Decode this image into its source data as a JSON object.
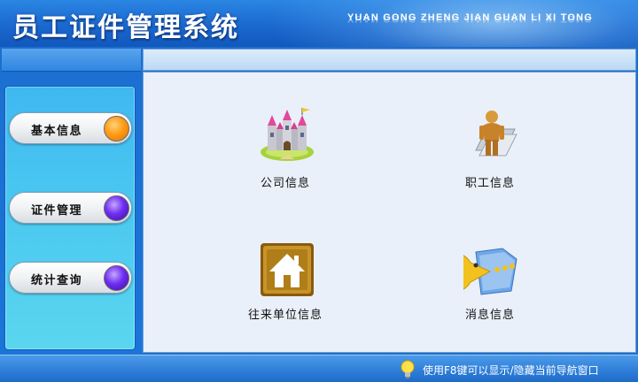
{
  "header": {
    "title": "员工证件管理系统",
    "subtitle": "YUAN GONG ZHENG JIAN GUAN LI XI TONG"
  },
  "sidebar": {
    "items": [
      {
        "label": "基本信息",
        "dot_color": "#ff9c16"
      },
      {
        "label": "证件管理",
        "dot_color": "#6e2ef0"
      },
      {
        "label": "统计查询",
        "dot_color": "#6e2ef0"
      }
    ]
  },
  "main": {
    "tiles": [
      {
        "label": "公司信息",
        "icon": "castle-icon"
      },
      {
        "label": "职工信息",
        "icon": "person-icon"
      },
      {
        "label": "往来单位信息",
        "icon": "house-icon"
      },
      {
        "label": "消息信息",
        "icon": "pacman-folder-icon"
      }
    ]
  },
  "footer": {
    "hint": "使用F8键可以显示/隐藏当前导航窗口",
    "icon": "lightbulb-icon"
  },
  "colors": {
    "header_blue": "#1a68cf",
    "panel_cyan": "#49c6f0",
    "main_bg": "#e9f0f9"
  }
}
